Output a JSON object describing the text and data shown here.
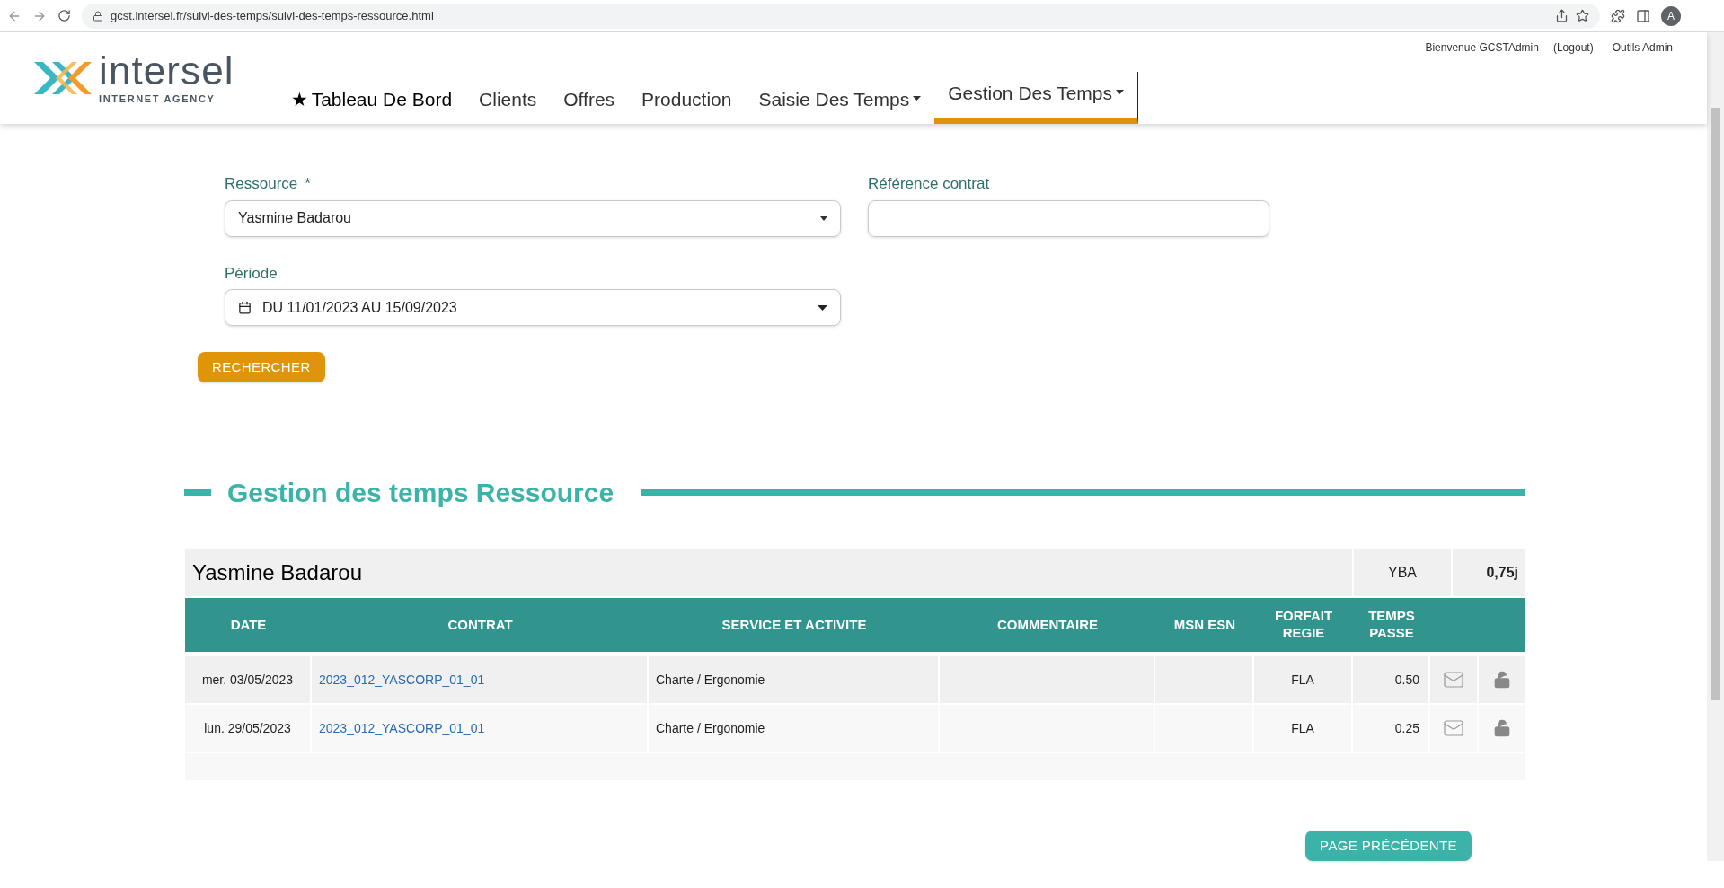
{
  "browser": {
    "url": "gcst.intersel.fr/suivi-des-temps/suivi-des-temps-ressource.html",
    "avatar": "A"
  },
  "header": {
    "logo": {
      "name": "intersel",
      "tagline": "INTERNET AGENCY"
    },
    "user_links": [
      {
        "label": "Bienvenue GCSTAdmin"
      },
      {
        "label": "(Logout)"
      },
      {
        "label": "Outils Admin"
      }
    ],
    "nav": [
      {
        "label": "Tableau De Bord",
        "star": "★",
        "dropdown": false,
        "selected": false
      },
      {
        "label": "Clients",
        "dropdown": false,
        "selected": false
      },
      {
        "label": "Offres",
        "dropdown": false,
        "selected": false
      },
      {
        "label": "Production",
        "dropdown": false,
        "selected": false
      },
      {
        "label": "Saisie Des Temps",
        "dropdown": true,
        "selected": false
      },
      {
        "label": "Gestion Des Temps",
        "dropdown": true,
        "selected": true
      }
    ]
  },
  "form": {
    "ressource": {
      "label": "Ressource",
      "required": "*",
      "value": "Yasmine Badarou"
    },
    "reference": {
      "label": "Référence contrat"
    },
    "periode": {
      "label": "Période",
      "value": "DU 11/01/2023 AU 15/09/2023"
    },
    "search_button": "RECHERCHER"
  },
  "section": {
    "title": "Gestion des temps Ressource"
  },
  "table": {
    "resource": {
      "name": "Yasmine Badarou",
      "code": "YBA",
      "total": "0,75j"
    },
    "columns": [
      "DATE",
      "CONTRAT",
      "SERVICE ET ACTIVITE",
      "COMMENTAIRE",
      "MSN ESN",
      "FORFAIT REGIE",
      "TEMPS PASSE"
    ],
    "rows": [
      {
        "date": "mer. 03/05/2023",
        "contract": "2023_012_YASCORP_01_01",
        "service": "Charte / Ergonomie",
        "type": "FLA",
        "time": "0.50",
        "locked": false
      },
      {
        "date": "lun. 29/05/2023",
        "contract": "2023_012_YASCORP_01_01",
        "service": "Charte / Ergonomie",
        "type": "FLA",
        "time": "0.25",
        "locked": false
      }
    ]
  },
  "back_button": "PAGE PRÉCÉDENTE"
}
